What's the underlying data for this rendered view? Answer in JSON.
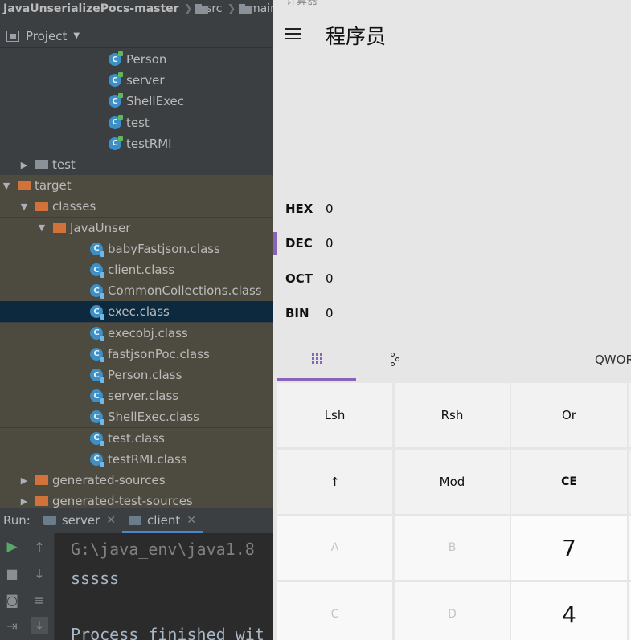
{
  "ide": {
    "breadcrumb": {
      "root": "JavaUnserializePocs-master",
      "src": "src",
      "main": "main"
    },
    "project_panel": {
      "label": "Project"
    },
    "tree": [
      {
        "label": "Person",
        "icon": "java-class-icon",
        "indent": 1,
        "state": "normal"
      },
      {
        "label": "server",
        "icon": "java-class-icon",
        "indent": 1,
        "state": "normal"
      },
      {
        "label": "ShellExec",
        "icon": "java-class-icon",
        "indent": 1,
        "state": "normal"
      },
      {
        "label": "test",
        "icon": "java-class-icon",
        "indent": 1,
        "state": "normal"
      },
      {
        "label": "testRMI",
        "icon": "java-class-icon",
        "indent": 1,
        "state": "normal"
      },
      {
        "label": "test",
        "icon": "folder-icon",
        "indent": 0,
        "state": "collapsed"
      },
      {
        "label": "target",
        "icon": "excluded-folder-icon",
        "indent": -1,
        "state": "expanded"
      },
      {
        "label": "classes",
        "icon": "excluded-folder-icon",
        "indent": 0,
        "state": "expanded"
      },
      {
        "label": "JavaUnser",
        "icon": "excluded-folder-icon",
        "indent": 1,
        "state": "expanded"
      },
      {
        "label": "babyFastjson.class",
        "icon": "class-file-icon",
        "indent": 2,
        "state": "normal"
      },
      {
        "label": "client.class",
        "icon": "class-file-icon",
        "indent": 2,
        "state": "normal"
      },
      {
        "label": "CommonCollections.class",
        "icon": "class-file-icon",
        "indent": 2,
        "state": "normal"
      },
      {
        "label": "exec.class",
        "icon": "class-file-icon",
        "indent": 2,
        "state": "selected"
      },
      {
        "label": "execobj.class",
        "icon": "class-file-icon",
        "indent": 2,
        "state": "normal"
      },
      {
        "label": "fastjsonPoc.class",
        "icon": "class-file-icon",
        "indent": 2,
        "state": "normal"
      },
      {
        "label": "Person.class",
        "icon": "class-file-icon",
        "indent": 2,
        "state": "normal"
      },
      {
        "label": "server.class",
        "icon": "class-file-icon",
        "indent": 2,
        "state": "normal"
      },
      {
        "label": "ShellExec.class",
        "icon": "class-file-icon",
        "indent": 2,
        "state": "normal"
      },
      {
        "label": "test.class",
        "icon": "class-file-icon",
        "indent": 2,
        "state": "normal"
      },
      {
        "label": "testRMI.class",
        "icon": "class-file-icon",
        "indent": 2,
        "state": "normal"
      },
      {
        "label": "generated-sources",
        "icon": "excluded-folder-icon",
        "indent": 0,
        "state": "collapsed"
      },
      {
        "label": "generated-test-sources",
        "icon": "excluded-folder-icon",
        "indent": 0,
        "state": "collapsed"
      }
    ],
    "run": {
      "label": "Run:",
      "tabs": [
        {
          "label": "server",
          "active": false
        },
        {
          "label": "client",
          "active": true
        }
      ],
      "console": [
        "G:\\java_env\\java1.8",
        "sssss",
        "",
        "Process finished wit"
      ]
    }
  },
  "calculator": {
    "title_partial": "计算器",
    "mode_title": "程序员",
    "radix": [
      {
        "label": "HEX",
        "value": "0",
        "selected": false
      },
      {
        "label": "DEC",
        "value": "0",
        "selected": true
      },
      {
        "label": "OCT",
        "value": "0",
        "selected": false
      },
      {
        "label": "BIN",
        "value": "0",
        "selected": false
      }
    ],
    "mode_tabs": {
      "word": "QWORD"
    },
    "keys": [
      {
        "label": "Lsh",
        "kind": "op"
      },
      {
        "label": "Rsh",
        "kind": "op"
      },
      {
        "label": "Or",
        "kind": "op"
      },
      {
        "label": "↑",
        "kind": "op"
      },
      {
        "label": "Mod",
        "kind": "op"
      },
      {
        "label": "CE",
        "kind": "ce"
      },
      {
        "label": "A",
        "kind": "hex"
      },
      {
        "label": "B",
        "kind": "hex"
      },
      {
        "label": "7",
        "kind": "num"
      },
      {
        "label": "C",
        "kind": "hex"
      },
      {
        "label": "D",
        "kind": "hex"
      },
      {
        "label": "4",
        "kind": "num"
      }
    ],
    "colors": {
      "accent": "#8764b8",
      "ide_bg": "#3c3f41",
      "selection": "#0d293e"
    }
  }
}
